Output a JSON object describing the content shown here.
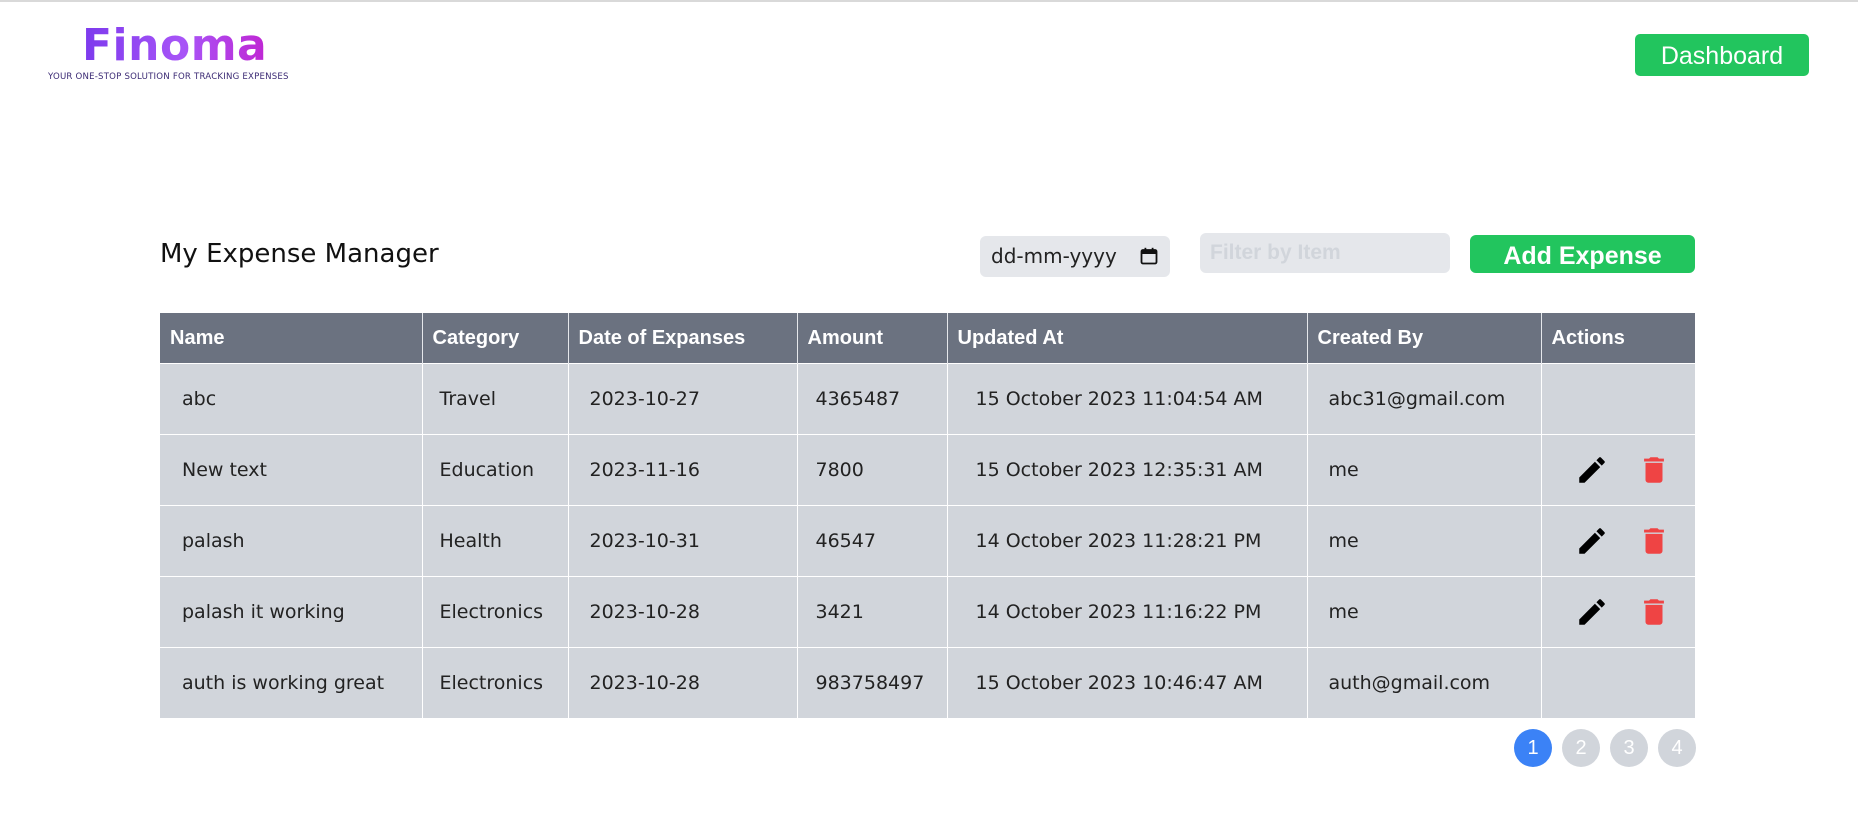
{
  "header": {
    "logo_text": "Finoma",
    "logo_tagline": "YOUR ONE-STOP SOLUTION FOR TRACKING EXPENSES",
    "dashboard_label": "Dashboard"
  },
  "main": {
    "title": "My Expense Manager",
    "date_placeholder": "dd-mm-yyyy",
    "filter_placeholder": "Filter by Item",
    "add_label": "Add Expense"
  },
  "table": {
    "columns": [
      "Name",
      "Category",
      "Date of Expanses",
      "Amount",
      "Updated At",
      "Created By",
      "Actions"
    ],
    "rows": [
      {
        "name": "abc",
        "category": "Travel",
        "date": "2023-10-27",
        "amount": "4365487",
        "updated": "15 October 2023 11:04:54 AM",
        "created_by": "abc31@gmail.com",
        "has_actions": false
      },
      {
        "name": "New text",
        "category": "Education",
        "date": "2023-11-16",
        "amount": "7800",
        "updated": "15 October 2023 12:35:31 AM",
        "created_by": "me",
        "has_actions": true
      },
      {
        "name": "palash",
        "category": "Health",
        "date": "2023-10-31",
        "amount": "46547",
        "updated": "14 October 2023 11:28:21 PM",
        "created_by": "me",
        "has_actions": true
      },
      {
        "name": "palash it working",
        "category": "Electronics",
        "date": "2023-10-28",
        "amount": "3421",
        "updated": "14 October 2023 11:16:22 PM",
        "created_by": "me",
        "has_actions": true
      },
      {
        "name": "auth is working great",
        "category": "Electronics",
        "date": "2023-10-28",
        "amount": "983758497",
        "updated": "15 October 2023 10:46:47 AM",
        "created_by": "auth@gmail.com",
        "has_actions": false
      }
    ],
    "action_icons": [
      "pencil-icon",
      "trash-icon"
    ]
  },
  "pagination": {
    "pages": [
      "1",
      "2",
      "3",
      "4"
    ],
    "current": "1"
  },
  "colors": {
    "accent_green": "#22c55e",
    "header_gray": "#6b7280",
    "row_gray": "#d1d5db",
    "delete_red": "#ef4444",
    "active_page_blue": "#3b82f6",
    "logo_purple": "#7c3aed"
  }
}
